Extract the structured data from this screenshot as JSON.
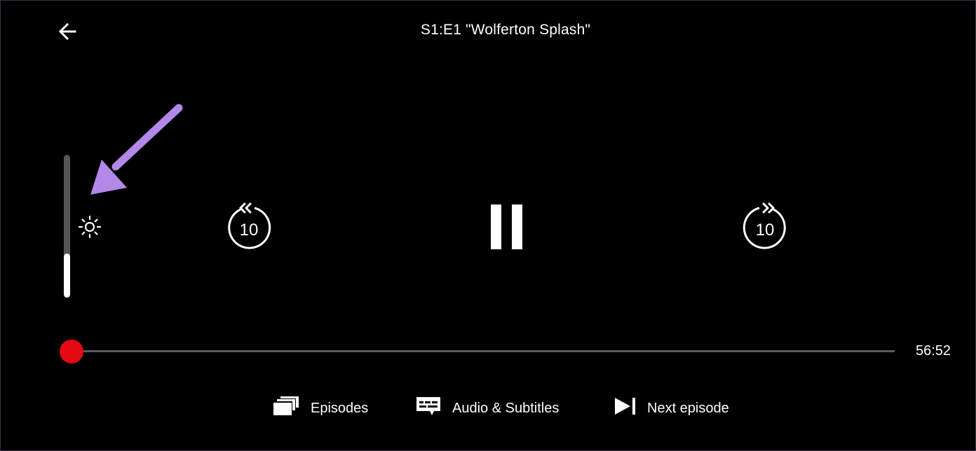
{
  "player": {
    "title": "S1:E1 \"Wolferton Splash\"",
    "time_remaining": "56:52",
    "progress_fraction": 0.0,
    "brightness_fraction": 0.31,
    "accent_color": "#e50914",
    "annotation_color": "#b388e8"
  },
  "controls": {
    "back_icon": "arrow-left-icon",
    "brightness_icon": "sun-icon",
    "rewind": {
      "icon": "rewind-10-icon",
      "label": "10"
    },
    "pause": {
      "icon": "pause-icon"
    },
    "forward": {
      "icon": "forward-10-icon",
      "label": "10"
    }
  },
  "actions": [
    {
      "icon": "episodes-stack-icon",
      "label": "Episodes"
    },
    {
      "icon": "subtitles-icon",
      "label": "Audio & Subtitles"
    },
    {
      "icon": "skip-next-icon",
      "label": "Next episode"
    }
  ]
}
